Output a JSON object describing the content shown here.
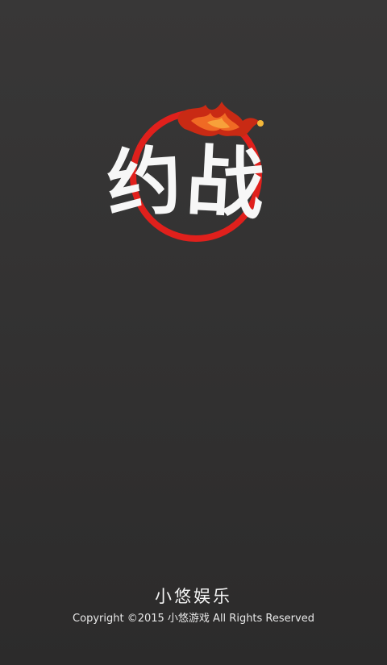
{
  "logo": {
    "char_1": "约",
    "char_2": "战",
    "ring_color": "#e0201c",
    "flame_color": "#d83a1a"
  },
  "footer": {
    "brand": "小悠娱乐",
    "copyright": "Copyright ©2015 小悠游戏 All Rights Reserved"
  },
  "colors": {
    "background": "#333232",
    "text": "#ffffff"
  }
}
